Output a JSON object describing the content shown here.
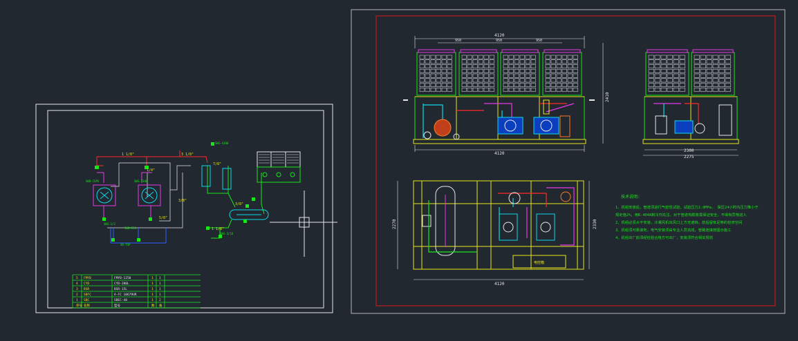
{
  "canvas": {
    "background": "#212830"
  },
  "colors": {
    "sheet_border": "#ffffff",
    "frame_red": "#e01818",
    "green": "#19e619",
    "cyan": "#10d8e8",
    "magenta": "#e83ae8",
    "blue": "#2a62ff",
    "yellow": "#e6e61c",
    "red": "#ff2a2a",
    "white": "#e8e8e8",
    "grey": "#b8b8b8",
    "orange": "#ff7a20"
  },
  "left_sheet": {
    "pipe_labels": [
      "1 1/8\"",
      "3 1/8\"",
      "7/8\"",
      "3/8\"",
      "1 1/8\"",
      "3/8\"",
      "5/8\"",
      "1/4\""
    ],
    "component_tags": [
      "SWS-4100",
      "SWB-CSPG",
      "SWS-TSHB",
      "SWB-CSG",
      "SWS-1/2",
      "SWS-3/18",
      "SB-TSP"
    ],
    "bom": [
      {
        "no": "5",
        "name": "FMYB",
        "model": "FMYB-1250",
        "qty": "1",
        "unit": "1"
      },
      {
        "no": "4",
        "name": "CYD",
        "model": "CYD-280L",
        "qty": "1",
        "unit": "1"
      },
      {
        "no": "3",
        "name": "BSR",
        "model": "BSR-15L",
        "qty": "1",
        "unit": "1"
      },
      {
        "no": "2",
        "name": "SBFC",
        "model": "A-FC 10679UR",
        "qty": "1",
        "unit": "1"
      },
      {
        "no": "1",
        "name": "SBC",
        "model": "SBEC-40",
        "qty": "1",
        "unit": "2"
      },
      {
        "no": "序号",
        "name": "名称",
        "model": "型号",
        "qty": "数",
        "unit": "备"
      }
    ]
  },
  "right_sheet": {
    "front": {
      "top_dim": "4120",
      "sub_dims": [
        "950",
        "950",
        "950"
      ],
      "bottom_dim": "4120",
      "height_dim": "2410"
    },
    "side": {
      "dims": [
        "2300",
        "2275"
      ]
    },
    "plan": {
      "left_dim": "2270",
      "right_dim": "2330",
      "bottom_dim": "4120",
      "box_label": "电控箱"
    },
    "notes": {
      "title": "技术说明:",
      "lines": [
        "1、机组安装后，管道须进行气密性试验，试验压力2.0MPa，   保压24小时内压力降小于",
        "    规定值2%，用R-404A制冷剂充注。对于管道热膨胀需保证安全，不得有异物进入",
        "2、机组必须水平安装，冷凝风机出风口上方无遮挡，前后留有足够的检修空间",
        "3、机组须可靠接地，电气安装须由专业人员完成，管路连接按图示施工",
        "4、机组出厂前须经检验合格方可出厂，安装须符合相关规范"
      ]
    }
  }
}
